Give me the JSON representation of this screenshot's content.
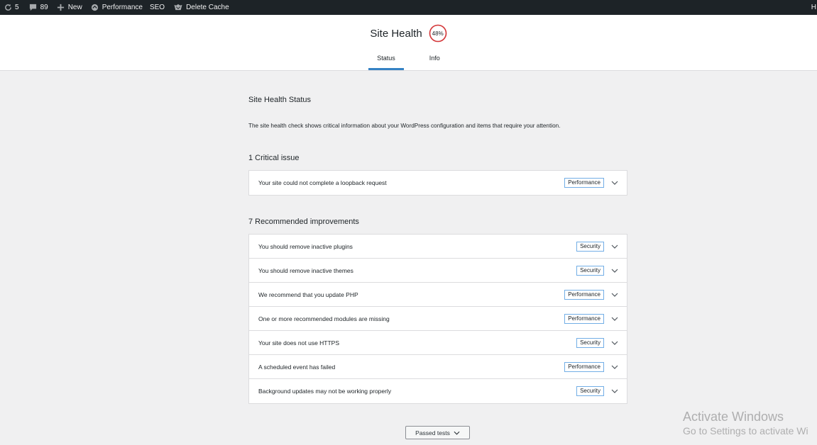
{
  "adminbar": {
    "updates_count": "5",
    "comments_count": "89",
    "new_label": "New",
    "performance_label": "Performance",
    "seo_label": "SEO",
    "delete_cache_label": "Delete Cache",
    "right_text": "H"
  },
  "header": {
    "title": "Site Health",
    "progress_label": "48%",
    "progress_value": 0.48,
    "tabs": [
      {
        "label": "Status",
        "active": true
      },
      {
        "label": "Info",
        "active": false
      }
    ]
  },
  "status": {
    "heading": "Site Health Status",
    "description": "The site health check shows critical information about your WordPress configuration and items that require your attention."
  },
  "critical": {
    "heading": "1 Critical issue",
    "items": [
      {
        "title": "Your site could not complete a loopback request",
        "badge": "Performance"
      }
    ]
  },
  "recommended": {
    "heading": "7 Recommended improvements",
    "items": [
      {
        "title": "You should remove inactive plugins",
        "badge": "Security"
      },
      {
        "title": "You should remove inactive themes",
        "badge": "Security"
      },
      {
        "title": "We recommend that you update PHP",
        "badge": "Performance"
      },
      {
        "title": "One or more recommended modules are missing",
        "badge": "Performance"
      },
      {
        "title": "Your site does not use HTTPS",
        "badge": "Security"
      },
      {
        "title": "A scheduled event has failed",
        "badge": "Performance"
      },
      {
        "title": "Background updates may not be working properly",
        "badge": "Security"
      }
    ]
  },
  "passed_tests_label": "Passed tests",
  "watermark": {
    "line1": "Activate Windows",
    "line2": "Go to Settings to activate Wi"
  },
  "colors": {
    "adminbar_bg": "#1d2327",
    "accent": "#3582c4",
    "progress_ring": "#d63638",
    "badge_border": "#72aee6"
  }
}
